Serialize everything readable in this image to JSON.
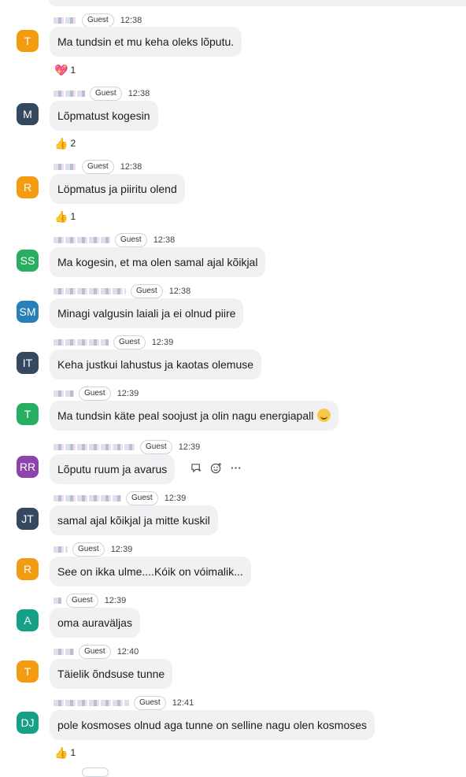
{
  "guest_label": "Guest",
  "messages": [
    {
      "initials": "T",
      "color": "#f39c12",
      "time": "12:38",
      "text": "Ma tundsin et mu keha oleks lõputu.",
      "reaction": {
        "glyph": "💖",
        "count": "1"
      }
    },
    {
      "initials": "M",
      "color": "#34495e",
      "time": "12:38",
      "text": "Lõpmatust kogesin",
      "reaction": {
        "glyph": "👍",
        "count": "2"
      }
    },
    {
      "initials": "R",
      "color": "#f39c12",
      "time": "12:38",
      "text": "Löpmatus ja piiritu olend",
      "reaction": {
        "glyph": "👍",
        "count": "1"
      }
    },
    {
      "initials": "SS",
      "color": "#27ae60",
      "time": "12:38",
      "text": "Ma kogesin, et ma olen samal ajal kõikjal"
    },
    {
      "initials": "SM",
      "color": "#2980b9",
      "time": "12:38",
      "text": "Minagi valgusin laiali ja ei olnud piire"
    },
    {
      "initials": "IT",
      "color": "#34495e",
      "time": "12:39",
      "text": "Keha justkui lahustus ja kaotas olemuse"
    },
    {
      "initials": "T",
      "color": "#27ae60",
      "time": "12:39",
      "text": "Ma tundsin käte peal soojust ja olin nagu energiapall"
    },
    {
      "initials": "RR",
      "color": "#8e44ad",
      "time": "12:39",
      "text": "Lõputu ruum ja avarus"
    },
    {
      "initials": "JT",
      "color": "#34495e",
      "time": "12:39",
      "text": "samal ajal kõikjal ja mitte kuskil"
    },
    {
      "initials": "R",
      "color": "#f39c12",
      "time": "12:39",
      "text": "See on ikka ulme....Kóik on vóimalik..."
    },
    {
      "initials": "A",
      "color": "#16a085",
      "time": "12:39",
      "text": "oma auraväljas"
    },
    {
      "initials": "T",
      "color": "#f39c12",
      "time": "12:40",
      "text": "Täielik õndsuse tunne"
    },
    {
      "initials": "DJ",
      "color": "#16a085",
      "time": "12:41",
      "text": "pole kosmoses olnud aga tunne on selline nagu olen kosmoses",
      "reaction": {
        "glyph": "👍",
        "count": "1"
      }
    }
  ],
  "hover_actions": [
    "thread-reply-icon",
    "add-reaction-icon",
    "more-options-icon"
  ]
}
